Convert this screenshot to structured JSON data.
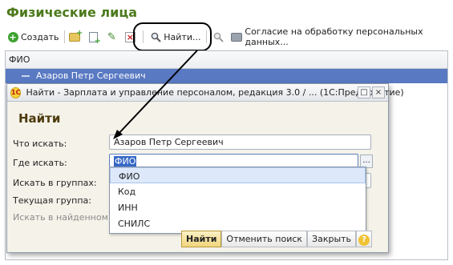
{
  "page_title": "Физические лица",
  "toolbar": {
    "create_label": "Создать",
    "find_label": "Найти...",
    "consent_label": "Согласие на обработку персональных данных..."
  },
  "grid": {
    "column_header": "ФИО",
    "selected_row": "Азаров Петр Сергеевич"
  },
  "dialog": {
    "logo": "1С",
    "title": "Найти - Зарплата и управление персоналом, редакция 3.0 / ...  (1С:Предприятие)",
    "heading": "Найти",
    "what_label": "Что искать:",
    "what_value": "Азаров Петр Сергеевич",
    "where_label": "Где искать:",
    "where_value": "ФИО",
    "dots_label": "...",
    "groups_label": "Искать в группах:",
    "current_group_label": "Текущая группа:",
    "search_found_label": "Искать в найденном:",
    "dropdown_options": [
      "ФИО",
      "Код",
      "ИНН",
      "СНИЛС"
    ],
    "dropdown_selected": "ФИО",
    "buttons": {
      "find": "Найти",
      "cancel_search": "Отменить поиск",
      "close": "Закрыть",
      "help": "?"
    }
  },
  "colors": {
    "title_green": "#4c7a1c",
    "selection_blue": "#5979c2",
    "dialog_bg": "#f4f2e9",
    "primary_button": "#f1d67c"
  },
  "icons": [
    "create-icon",
    "add-folder-icon",
    "copy-icon",
    "edit-icon",
    "delete-icon",
    "find-icon",
    "search-icon",
    "print-icon",
    "logo-1c-icon"
  ]
}
